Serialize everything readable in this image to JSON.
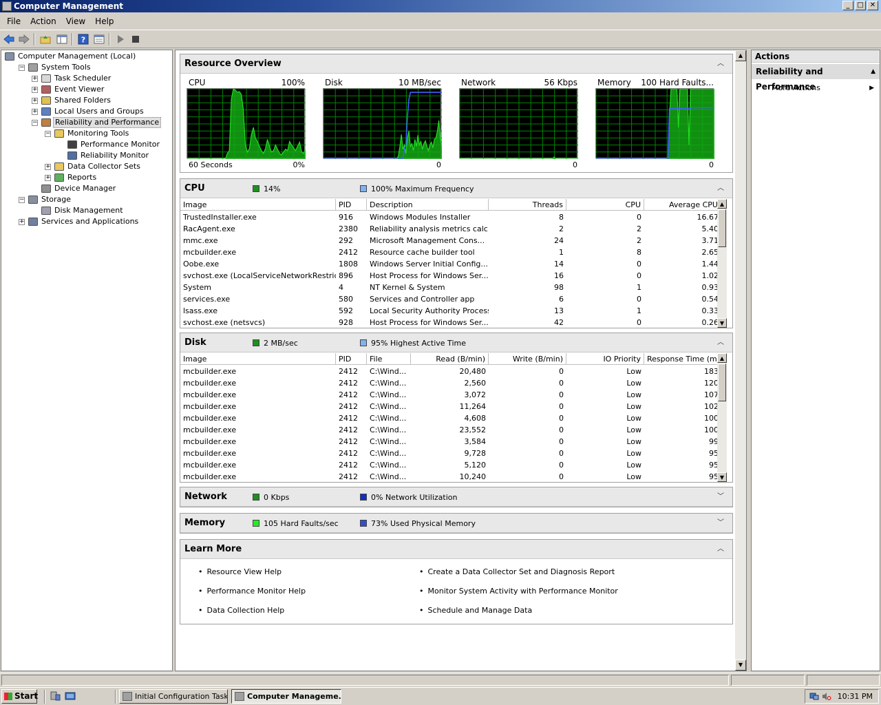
{
  "window": {
    "title": "Computer Management"
  },
  "menu": [
    "File",
    "Action",
    "View",
    "Help"
  ],
  "tree": [
    {
      "label": "Computer Management (Local)",
      "level": 0,
      "expander": "",
      "icon": "computer-icon"
    },
    {
      "label": "System Tools",
      "level": 1,
      "expander": "−",
      "icon": "tools-icon"
    },
    {
      "label": "Task Scheduler",
      "level": 2,
      "expander": "+",
      "icon": "clock-icon"
    },
    {
      "label": "Event Viewer",
      "level": 2,
      "expander": "+",
      "icon": "event-viewer-icon"
    },
    {
      "label": "Shared Folders",
      "level": 2,
      "expander": "+",
      "icon": "shared-folder-icon"
    },
    {
      "label": "Local Users and Groups",
      "level": 2,
      "expander": "+",
      "icon": "users-icon"
    },
    {
      "label": "Reliability and Performance",
      "level": 2,
      "expander": "−",
      "icon": "gauge-icon",
      "selected": true
    },
    {
      "label": "Monitoring Tools",
      "level": 3,
      "expander": "−",
      "icon": "folder-icon"
    },
    {
      "label": "Performance Monitor",
      "level": 4,
      "expander": "",
      "icon": "perf-monitor-icon"
    },
    {
      "label": "Reliability Monitor",
      "level": 4,
      "expander": "",
      "icon": "reliability-monitor-icon"
    },
    {
      "label": "Data Collector Sets",
      "level": 3,
      "expander": "+",
      "icon": "folder-icon"
    },
    {
      "label": "Reports",
      "level": 3,
      "expander": "+",
      "icon": "report-icon"
    },
    {
      "label": "Device Manager",
      "level": 2,
      "expander": "",
      "icon": "device-manager-icon"
    },
    {
      "label": "Storage",
      "level": 1,
      "expander": "−",
      "icon": "storage-icon"
    },
    {
      "label": "Disk Management",
      "level": 2,
      "expander": "",
      "icon": "disk-icon"
    },
    {
      "label": "Services and Applications",
      "level": 1,
      "expander": "+",
      "icon": "services-icon"
    }
  ],
  "overview": {
    "title": "Resource Overview",
    "graphs": [
      {
        "name": "CPU",
        "max": "100%",
        "bottom_left": "60 Seconds",
        "bottom_right": "0%"
      },
      {
        "name": "Disk",
        "max": "10 MB/sec",
        "bottom_left": "",
        "bottom_right": "0"
      },
      {
        "name": "Network",
        "max": "56 Kbps",
        "bottom_left": "",
        "bottom_right": "0"
      },
      {
        "name": "Memory",
        "max": "100 Hard Faults...",
        "bottom_left": "",
        "bottom_right": "0"
      }
    ]
  },
  "cpu": {
    "title": "CPU",
    "stat1": "14%",
    "stat2": "100% Maximum Frequency",
    "stat1_color": "#1f8f1f",
    "stat2_color": "#7fb2f0",
    "columns": [
      "Image",
      "PID",
      "Description",
      "Threads",
      "CPU",
      "Average CPU"
    ],
    "rows": [
      [
        "TrustedInstaller.exe",
        "916",
        "Windows Modules Installer",
        "8",
        "0",
        "16.67"
      ],
      [
        "RacAgent.exe",
        "2380",
        "Reliability analysis metrics calc...",
        "2",
        "2",
        "5.40"
      ],
      [
        "mmc.exe",
        "292",
        "Microsoft Management Cons...",
        "24",
        "2",
        "3.71"
      ],
      [
        "mcbuilder.exe",
        "2412",
        "Resource cache builder tool",
        "1",
        "8",
        "2.65"
      ],
      [
        "Oobe.exe",
        "1808",
        "Windows Server Initial Config...",
        "14",
        "0",
        "1.44"
      ],
      [
        "svchost.exe (LocalServiceNetworkRestrict...",
        "896",
        "Host Process for Windows Ser...",
        "16",
        "0",
        "1.02"
      ],
      [
        "System",
        "4",
        "NT Kernel & System",
        "98",
        "1",
        "0.93"
      ],
      [
        "services.exe",
        "580",
        "Services and Controller app",
        "6",
        "0",
        "0.54"
      ],
      [
        "lsass.exe",
        "592",
        "Local Security Authority Process",
        "13",
        "1",
        "0.33"
      ],
      [
        "svchost.exe (netsvcs)",
        "928",
        "Host Process for Windows Ser...",
        "42",
        "0",
        "0.26"
      ]
    ]
  },
  "disk": {
    "title": "Disk",
    "stat1": "2 MB/sec",
    "stat2": "95% Highest Active Time",
    "stat1_color": "#1f8f1f",
    "stat2_color": "#7fb2f0",
    "columns": [
      "Image",
      "PID",
      "File",
      "Read (B/min)",
      "Write (B/min)",
      "IO Priority",
      "Response Time (ms)"
    ],
    "rows": [
      [
        "mcbuilder.exe",
        "2412",
        "C:\\Wind...",
        "20,480",
        "0",
        "Low",
        "183"
      ],
      [
        "mcbuilder.exe",
        "2412",
        "C:\\Wind...",
        "2,560",
        "0",
        "Low",
        "120"
      ],
      [
        "mcbuilder.exe",
        "2412",
        "C:\\Wind...",
        "3,072",
        "0",
        "Low",
        "107"
      ],
      [
        "mcbuilder.exe",
        "2412",
        "C:\\Wind...",
        "11,264",
        "0",
        "Low",
        "102"
      ],
      [
        "mcbuilder.exe",
        "2412",
        "C:\\Wind...",
        "4,608",
        "0",
        "Low",
        "100"
      ],
      [
        "mcbuilder.exe",
        "2412",
        "C:\\Wind...",
        "23,552",
        "0",
        "Low",
        "100"
      ],
      [
        "mcbuilder.exe",
        "2412",
        "C:\\Wind...",
        "3,584",
        "0",
        "Low",
        "99"
      ],
      [
        "mcbuilder.exe",
        "2412",
        "C:\\Wind...",
        "9,728",
        "0",
        "Low",
        "95"
      ],
      [
        "mcbuilder.exe",
        "2412",
        "C:\\Wind...",
        "5,120",
        "0",
        "Low",
        "95"
      ],
      [
        "mcbuilder.exe",
        "2412",
        "C:\\Wind...",
        "10,240",
        "0",
        "Low",
        "95"
      ]
    ]
  },
  "network": {
    "title": "Network",
    "stat1": "0 Kbps",
    "stat2": "0% Network Utilization",
    "stat1_color": "#1f8f1f",
    "stat2_color": "#1030c0"
  },
  "memory": {
    "title": "Memory",
    "stat1": "105 Hard Faults/sec",
    "stat2": "73% Used Physical Memory",
    "stat1_color": "#22ee22",
    "stat2_color": "#3050d0"
  },
  "learn": {
    "title": "Learn More",
    "left": [
      "Resource View Help",
      "Performance Monitor Help",
      "Data Collection Help"
    ],
    "right": [
      "Create a Data Collector Set and Diagnosis Report",
      "Monitor System Activity with Performance Monitor",
      "Schedule and Manage Data"
    ]
  },
  "actions": {
    "header": "Actions",
    "section": "Reliability and Performance",
    "items": [
      "More Actions"
    ]
  },
  "taskbar": {
    "start": "Start",
    "tasks": [
      {
        "label": "Initial Configuration Tasks",
        "active": false
      },
      {
        "label": "Computer Manageme...",
        "active": true
      }
    ],
    "clock": "10:31 PM"
  },
  "colors": {
    "graph_line_green": "#22dd22",
    "graph_line_blue": "#4060ff",
    "graph_grid": "#008800"
  }
}
